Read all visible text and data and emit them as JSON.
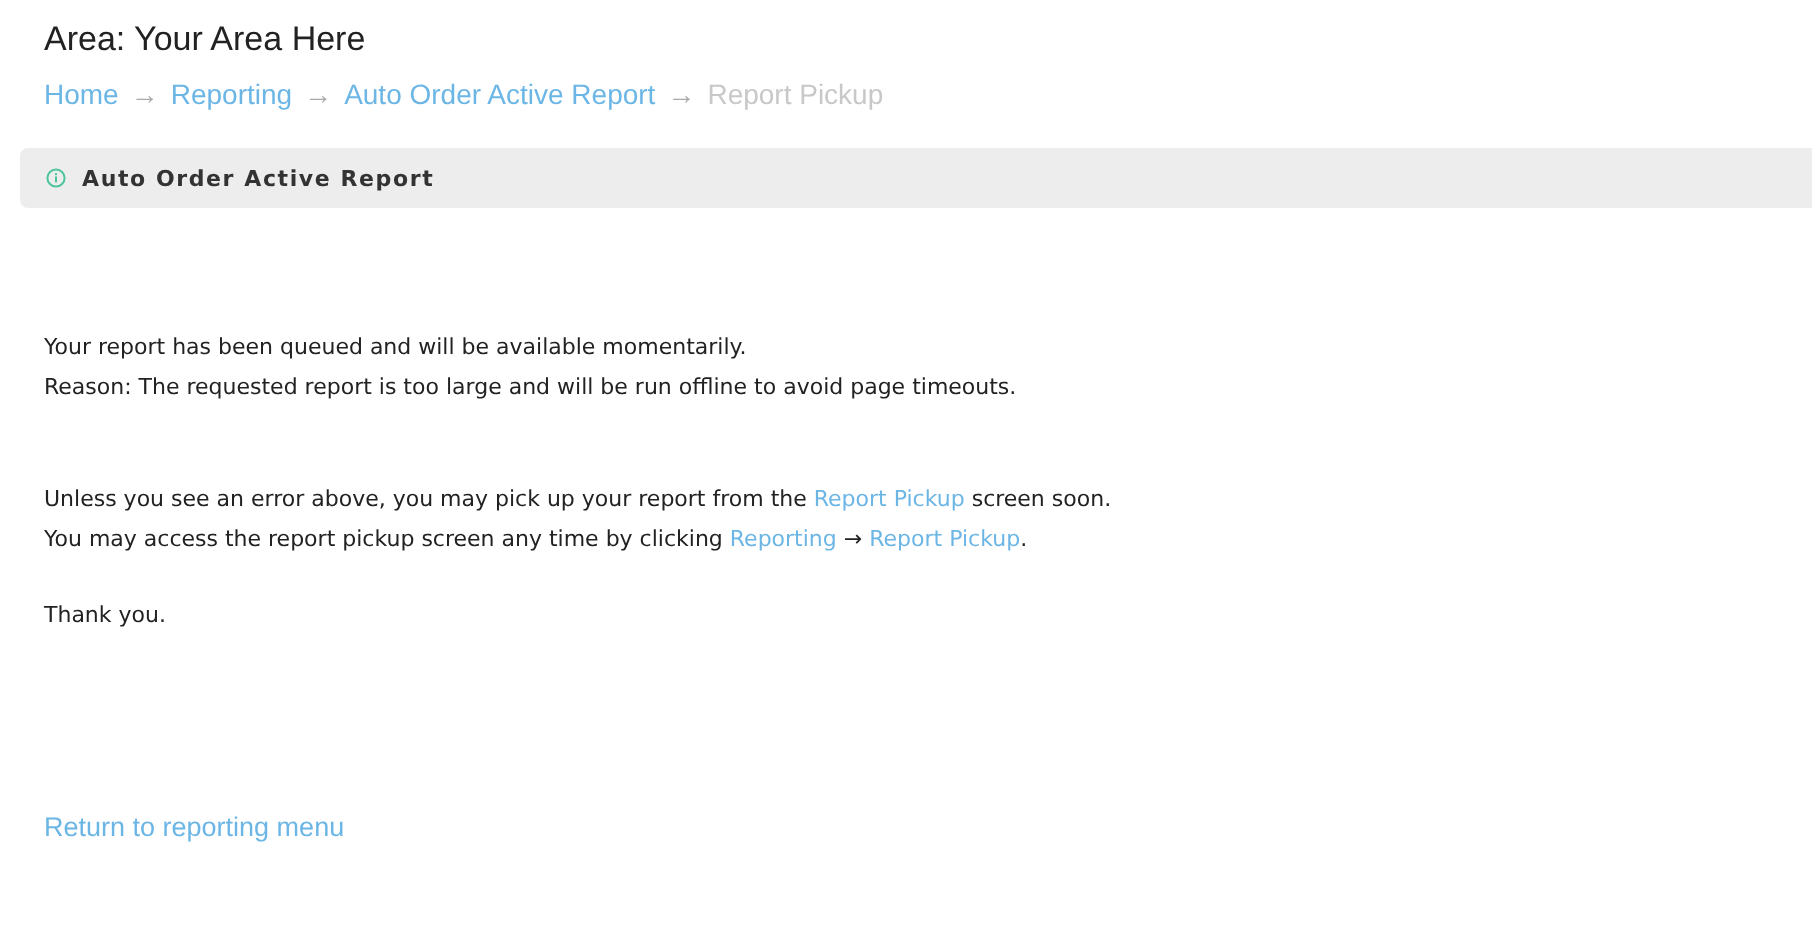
{
  "area_title": "Area: Your Area Here",
  "breadcrumb": {
    "separator": "→",
    "items": [
      {
        "label": "Home",
        "current": false
      },
      {
        "label": "Reporting",
        "current": false
      },
      {
        "label": "Auto Order Active Report",
        "current": false
      },
      {
        "label": "Report Pickup",
        "current": true
      }
    ]
  },
  "panel": {
    "title": "Auto Order Active Report"
  },
  "paragraphs": [
    [
      [
        {
          "text": "Your report has been queued and will be available momentarily."
        }
      ],
      [
        {
          "text": "Reason: The requested report is too large and will be run offline to avoid page timeouts."
        }
      ]
    ],
    [
      [
        {
          "text": "Unless you see an error above, you may pick up your report from the "
        },
        {
          "text": "Report Pickup",
          "link": true
        },
        {
          "text": " screen soon."
        }
      ],
      [
        {
          "text": "You may access the report pickup screen any time by clicking "
        },
        {
          "text": "Reporting",
          "link": true
        },
        {
          "text": "  → "
        },
        {
          "text": "Report Pickup",
          "link": true
        },
        {
          "text": "."
        }
      ]
    ],
    [
      [
        {
          "text": "Thank you."
        }
      ]
    ]
  ],
  "return_link": "Return to reporting menu"
}
